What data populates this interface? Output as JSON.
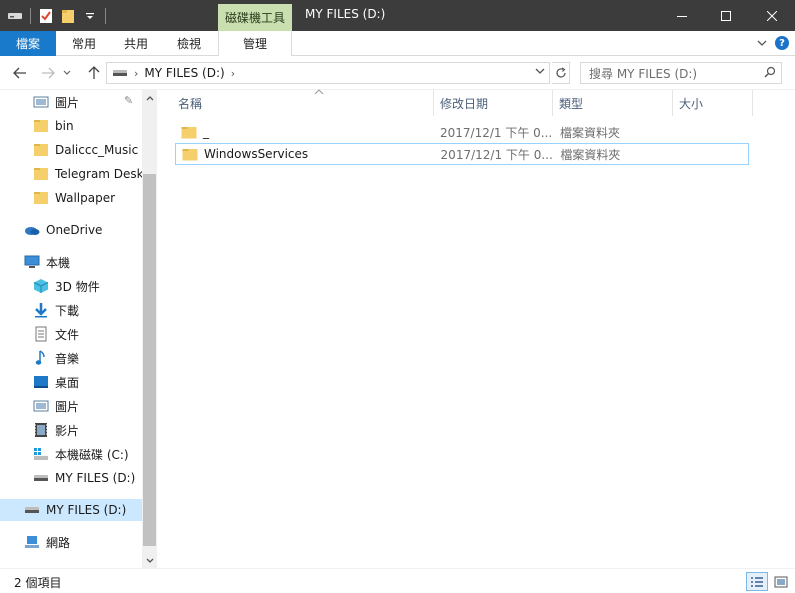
{
  "window": {
    "title": "MY FILES (D:)",
    "context_tab_title": "磁碟機工具"
  },
  "ribbon": {
    "tabs": [
      {
        "label": "檔案"
      },
      {
        "label": "常用"
      },
      {
        "label": "共用"
      },
      {
        "label": "檢視"
      },
      {
        "label": "管理"
      }
    ]
  },
  "address": {
    "breadcrumb": [
      {
        "label": "MY FILES (D:)"
      }
    ],
    "search_placeholder": "搜尋 MY FILES (D:)"
  },
  "nav": {
    "items": [
      {
        "label": "圖片",
        "icon": "pictures-icon"
      },
      {
        "label": "bin",
        "icon": "folder-icon"
      },
      {
        "label": "Daliccc_Music",
        "icon": "folder-icon"
      },
      {
        "label": "Telegram Deskt",
        "icon": "folder-icon"
      },
      {
        "label": "Wallpaper",
        "icon": "folder-icon"
      },
      {
        "label": "OneDrive",
        "icon": "onedrive-icon"
      },
      {
        "label": "本機",
        "icon": "this-pc-icon"
      },
      {
        "label": "3D 物件",
        "icon": "3d-objects-icon"
      },
      {
        "label": "下載",
        "icon": "downloads-icon"
      },
      {
        "label": "文件",
        "icon": "documents-icon"
      },
      {
        "label": "音樂",
        "icon": "music-icon"
      },
      {
        "label": "桌面",
        "icon": "desktop-icon"
      },
      {
        "label": "圖片",
        "icon": "pictures-icon"
      },
      {
        "label": "影片",
        "icon": "videos-icon"
      },
      {
        "label": "本機磁碟 (C:)",
        "icon": "system-drive-icon"
      },
      {
        "label": "MY FILES (D:)",
        "icon": "drive-icon"
      },
      {
        "label": "MY FILES (D:)",
        "icon": "drive-icon"
      },
      {
        "label": "網路",
        "icon": "network-icon"
      }
    ]
  },
  "columns": {
    "name": "名稱",
    "date": "修改日期",
    "type": "類型",
    "size": "大小"
  },
  "files": [
    {
      "name": "_",
      "date": "2017/12/1 下午 0...",
      "type": "檔案資料夾",
      "size": ""
    },
    {
      "name": "WindowsServices",
      "date": "2017/12/1 下午 0...",
      "type": "檔案資料夾",
      "size": ""
    }
  ],
  "status": {
    "item_count": "2 個項目"
  },
  "colors": {
    "accent": "#1979ca",
    "titlebar": "#3c3c3c",
    "context_tab": "#c9dfb0",
    "folder": "#f5cf6b",
    "selection": "#cce8ff"
  }
}
